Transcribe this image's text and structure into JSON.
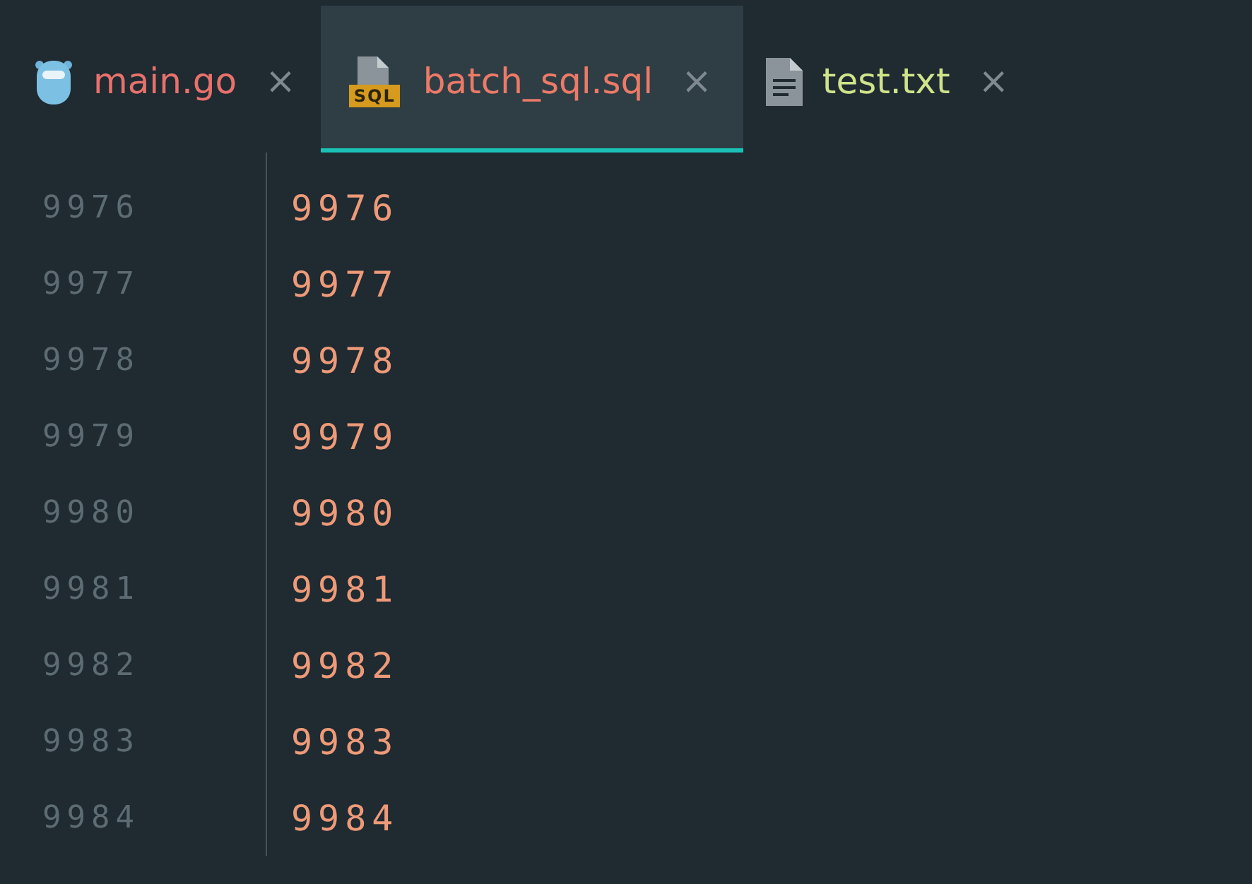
{
  "tabs": [
    {
      "kind": "gopher",
      "label": "main.go",
      "close": "×",
      "color": "#e8716c",
      "selected": false
    },
    {
      "kind": "sql",
      "icon_text": "SQL",
      "label": "batch_sql.sql",
      "close": "×",
      "color": "#ec7a68",
      "selected": true
    },
    {
      "kind": "doc",
      "label": "test.txt",
      "close": "×",
      "color": "#cfe38a",
      "selected": false
    }
  ],
  "editor": {
    "lines": [
      {
        "number": "9976",
        "code": "9976"
      },
      {
        "number": "9977",
        "code": "9977"
      },
      {
        "number": "9978",
        "code": "9978"
      },
      {
        "number": "9979",
        "code": "9979"
      },
      {
        "number": "9980",
        "code": "9980"
      },
      {
        "number": "9981",
        "code": "9981"
      },
      {
        "number": "9982",
        "code": "9982"
      },
      {
        "number": "9983",
        "code": "9983"
      },
      {
        "number": "9984",
        "code": "9984"
      }
    ]
  }
}
